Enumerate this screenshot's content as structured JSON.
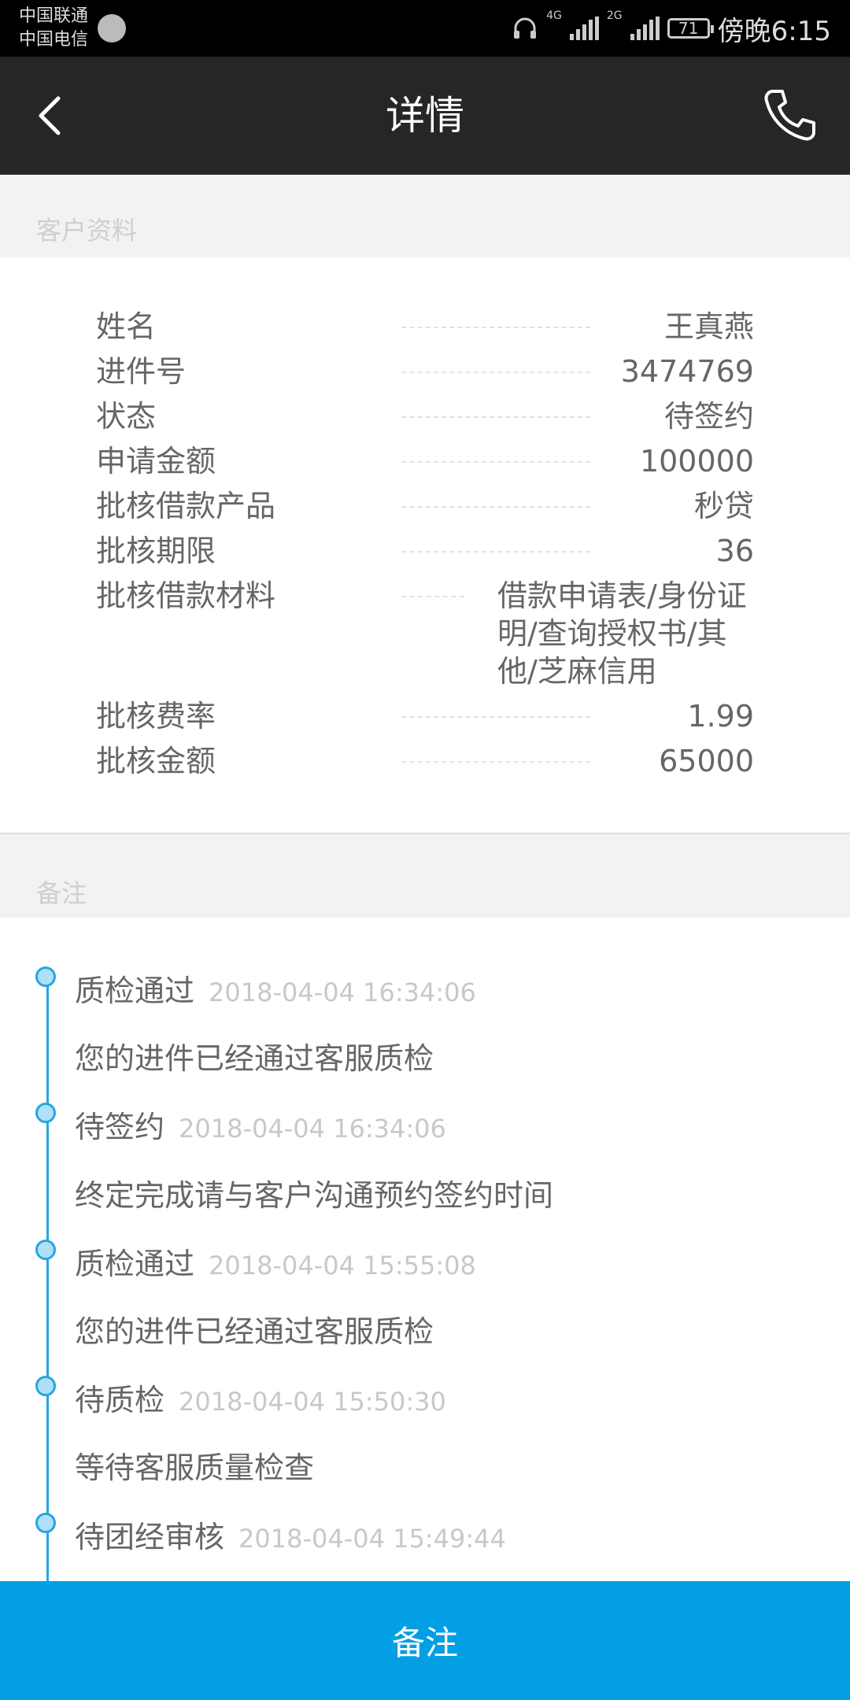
{
  "status_bar": {
    "carrier1": "中国联通",
    "carrier2": "中国电信",
    "net1": "4G",
    "net2": "2G",
    "battery": "71",
    "time": "傍晚6:15"
  },
  "header": {
    "title": "详情"
  },
  "customer_section": {
    "label": "客户资料",
    "rows": [
      {
        "label": "姓名",
        "value": "王真燕"
      },
      {
        "label": "进件号",
        "value": "3474769"
      },
      {
        "label": "状态",
        "value": "待签约"
      },
      {
        "label": "申请金额",
        "value": "100000"
      },
      {
        "label": "批核借款产品",
        "value": "秒贷"
      },
      {
        "label": "批核期限",
        "value": "36"
      },
      {
        "label": "批核借款材料",
        "value": "借款申请表/身份证明/查询授权书/其他/芝麻信用"
      },
      {
        "label": "批核费率",
        "value": "1.99"
      },
      {
        "label": "批核金额",
        "value": "65000"
      }
    ]
  },
  "remark_section": {
    "label": "备注",
    "items": [
      {
        "status": "质检通过",
        "time": "2018-04-04 16:34:06",
        "desc": "您的进件已经通过客服质检"
      },
      {
        "status": "待签约",
        "time": "2018-04-04 16:34:06",
        "desc": "终定完成请与客户沟通预约签约时间"
      },
      {
        "status": "质检通过",
        "time": "2018-04-04 15:55:08",
        "desc": "您的进件已经通过客服质检"
      },
      {
        "status": "待质检",
        "time": "2018-04-04 15:50:30",
        "desc": "等待客服质量检查"
      },
      {
        "status": "待团经审核",
        "time": "2018-04-04 15:49:44",
        "desc": ""
      }
    ]
  },
  "bottom_button": {
    "label": "备注"
  },
  "colors": {
    "accent": "#039fe4",
    "header_bg": "#262626",
    "timeline": "#22a7e6"
  }
}
